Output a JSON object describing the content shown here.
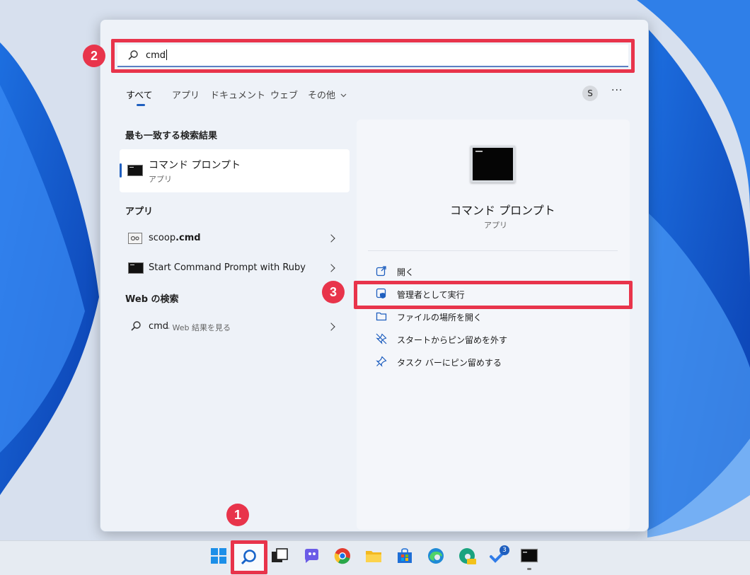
{
  "search": {
    "query": "cmd"
  },
  "badges": {
    "search_box": "2",
    "run_as_admin": "3",
    "taskbar_search": "1"
  },
  "tabs": [
    {
      "label": "すべて",
      "active": true
    },
    {
      "label": "アプリ"
    },
    {
      "label": "ドキュメント"
    },
    {
      "label": "ウェブ"
    },
    {
      "label": "その他"
    }
  ],
  "user_avatar": "S",
  "more_label": "···",
  "best_match": {
    "section": "最も一致する検索結果",
    "title": "コマンド プロンプト",
    "subtitle": "アプリ",
    "icon": "terminal-icon"
  },
  "apps": {
    "section": "アプリ",
    "items": [
      {
        "prefix": "scoop",
        "suffix": ".cmd",
        "icon": "script-file-icon"
      },
      {
        "label": "Start Command Prompt with Ruby",
        "icon": "terminal-icon"
      }
    ]
  },
  "web": {
    "section": "Web の検索",
    "query": "cmd",
    "suffix": " - Web 結果を見る"
  },
  "details": {
    "title": "コマンド プロンプト",
    "subtitle": "アプリ",
    "actions": [
      {
        "label": "開く",
        "icon": "open-external-icon"
      },
      {
        "label": "管理者として実行",
        "icon": "shield-admin-icon"
      },
      {
        "label": "ファイルの場所を開く",
        "icon": "folder-icon"
      },
      {
        "label": "スタートからピン留めを外す",
        "icon": "unpin-icon"
      },
      {
        "label": "タスク バーにピン留めする",
        "icon": "pin-icon"
      }
    ]
  },
  "taskbar": {
    "apps": [
      "windows-start",
      "search",
      "task-view",
      "chat",
      "chrome",
      "file-explorer",
      "store",
      "edge",
      "edge-canary",
      "todo",
      "command-prompt"
    ],
    "todo_badge": "3"
  },
  "colors": {
    "accent": "#1f5fbf",
    "highlight": "#e8344b",
    "panel": "#eef2f8"
  }
}
